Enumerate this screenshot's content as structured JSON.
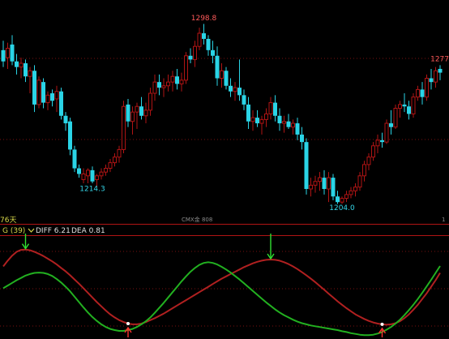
{
  "colors": {
    "background": "#000000",
    "bull": "#b01414",
    "bear": "#2ad4e6",
    "high_label": "#ff5a5a",
    "low_label": "#35d6e8",
    "grid": "#7a1010",
    "diff_line": "#b02020",
    "dea_line": "#22b020",
    "signal_up": "#ff3030",
    "signal_down": "#30e030"
  },
  "main_panel": {
    "left_label": "76天",
    "center_label": "CMX金 808",
    "right_label": "1"
  },
  "indicator_panel": {
    "name": "G (39)",
    "diff_label": "DIFF 6.21",
    "dea_label": "DEA 0.81"
  },
  "chart_data": [
    {
      "type": "candlestick",
      "ylim": [
        1195,
        1310
      ],
      "annotations": [
        {
          "text": "1298.8",
          "role": "high",
          "value": 1298.8,
          "index": 45
        },
        {
          "text": "1214.3",
          "role": "low",
          "value": 1214.3,
          "index": 20
        },
        {
          "text": "1204.0",
          "role": "low",
          "value": 1204.0,
          "index": 76
        },
        {
          "text": "1277",
          "role": "high",
          "value": 1277,
          "index": 98
        }
      ],
      "candles": [
        {
          "o": 1285,
          "h": 1290,
          "l": 1276,
          "c": 1279,
          "bull": false
        },
        {
          "o": 1281,
          "h": 1289,
          "l": 1275,
          "c": 1286,
          "bull": true
        },
        {
          "o": 1288,
          "h": 1293,
          "l": 1277,
          "c": 1279,
          "bull": false
        },
        {
          "o": 1279,
          "h": 1283,
          "l": 1272,
          "c": 1276,
          "bull": false
        },
        {
          "o": 1276,
          "h": 1281,
          "l": 1270,
          "c": 1278,
          "bull": true
        },
        {
          "o": 1278,
          "h": 1280,
          "l": 1268,
          "c": 1271,
          "bull": false
        },
        {
          "o": 1271,
          "h": 1276,
          "l": 1262,
          "c": 1274,
          "bull": true
        },
        {
          "o": 1274,
          "h": 1277,
          "l": 1252,
          "c": 1256,
          "bull": false
        },
        {
          "o": 1256,
          "h": 1271,
          "l": 1254,
          "c": 1269,
          "bull": true
        },
        {
          "o": 1268,
          "h": 1270,
          "l": 1254,
          "c": 1257,
          "bull": false
        },
        {
          "o": 1257,
          "h": 1263,
          "l": 1253,
          "c": 1261,
          "bull": true
        },
        {
          "o": 1262,
          "h": 1264,
          "l": 1255,
          "c": 1258,
          "bull": false
        },
        {
          "o": 1259,
          "h": 1266,
          "l": 1252,
          "c": 1263,
          "bull": true
        },
        {
          "o": 1263,
          "h": 1265,
          "l": 1248,
          "c": 1250,
          "bull": false
        },
        {
          "o": 1250,
          "h": 1252,
          "l": 1242,
          "c": 1246,
          "bull": false
        },
        {
          "o": 1247,
          "h": 1249,
          "l": 1229,
          "c": 1232,
          "bull": false
        },
        {
          "o": 1232,
          "h": 1234,
          "l": 1220,
          "c": 1222,
          "bull": false
        },
        {
          "o": 1222,
          "h": 1224,
          "l": 1217,
          "c": 1219,
          "bull": false
        },
        {
          "o": 1219,
          "h": 1222,
          "l": 1214,
          "c": 1216,
          "bull": true
        },
        {
          "o": 1218,
          "h": 1222,
          "l": 1214,
          "c": 1221,
          "bull": true
        },
        {
          "o": 1221,
          "h": 1223,
          "l": 1214,
          "c": 1215,
          "bull": false
        },
        {
          "o": 1216,
          "h": 1219,
          "l": 1212,
          "c": 1218,
          "bull": true
        },
        {
          "o": 1218,
          "h": 1222,
          "l": 1216,
          "c": 1220,
          "bull": true
        },
        {
          "o": 1220,
          "h": 1224,
          "l": 1218,
          "c": 1222,
          "bull": true
        },
        {
          "o": 1222,
          "h": 1227,
          "l": 1220,
          "c": 1225,
          "bull": true
        },
        {
          "o": 1225,
          "h": 1230,
          "l": 1223,
          "c": 1228,
          "bull": true
        },
        {
          "o": 1228,
          "h": 1234,
          "l": 1225,
          "c": 1232,
          "bull": true
        },
        {
          "o": 1232,
          "h": 1258,
          "l": 1230,
          "c": 1255,
          "bull": true
        },
        {
          "o": 1256,
          "h": 1259,
          "l": 1244,
          "c": 1247,
          "bull": false
        },
        {
          "o": 1247,
          "h": 1255,
          "l": 1240,
          "c": 1252,
          "bull": true
        },
        {
          "o": 1252,
          "h": 1257,
          "l": 1243,
          "c": 1255,
          "bull": true
        },
        {
          "o": 1255,
          "h": 1260,
          "l": 1248,
          "c": 1250,
          "bull": false
        },
        {
          "o": 1250,
          "h": 1257,
          "l": 1246,
          "c": 1253,
          "bull": true
        },
        {
          "o": 1253,
          "h": 1265,
          "l": 1250,
          "c": 1262,
          "bull": true
        },
        {
          "o": 1262,
          "h": 1272,
          "l": 1258,
          "c": 1268,
          "bull": true
        },
        {
          "o": 1268,
          "h": 1272,
          "l": 1261,
          "c": 1265,
          "bull": false
        },
        {
          "o": 1265,
          "h": 1270,
          "l": 1260,
          "c": 1266,
          "bull": true
        },
        {
          "o": 1266,
          "h": 1272,
          "l": 1263,
          "c": 1268,
          "bull": true
        },
        {
          "o": 1268,
          "h": 1274,
          "l": 1263,
          "c": 1271,
          "bull": true
        },
        {
          "o": 1271,
          "h": 1275,
          "l": 1264,
          "c": 1267,
          "bull": false
        },
        {
          "o": 1267,
          "h": 1273,
          "l": 1263,
          "c": 1269,
          "bull": true
        },
        {
          "o": 1269,
          "h": 1284,
          "l": 1267,
          "c": 1282,
          "bull": true
        },
        {
          "o": 1282,
          "h": 1286,
          "l": 1278,
          "c": 1280,
          "bull": false
        },
        {
          "o": 1280,
          "h": 1290,
          "l": 1276,
          "c": 1287,
          "bull": true
        },
        {
          "o": 1287,
          "h": 1297,
          "l": 1285,
          "c": 1294,
          "bull": true
        },
        {
          "o": 1294,
          "h": 1299,
          "l": 1288,
          "c": 1291,
          "bull": false
        },
        {
          "o": 1291,
          "h": 1293,
          "l": 1282,
          "c": 1285,
          "bull": false
        },
        {
          "o": 1285,
          "h": 1290,
          "l": 1278,
          "c": 1282,
          "bull": false
        },
        {
          "o": 1282,
          "h": 1287,
          "l": 1266,
          "c": 1270,
          "bull": false
        },
        {
          "o": 1270,
          "h": 1278,
          "l": 1265,
          "c": 1274,
          "bull": true
        },
        {
          "o": 1274,
          "h": 1276,
          "l": 1264,
          "c": 1266,
          "bull": false
        },
        {
          "o": 1266,
          "h": 1270,
          "l": 1260,
          "c": 1263,
          "bull": false
        },
        {
          "o": 1263,
          "h": 1268,
          "l": 1258,
          "c": 1265,
          "bull": true
        },
        {
          "o": 1265,
          "h": 1280,
          "l": 1258,
          "c": 1261,
          "bull": false
        },
        {
          "o": 1261,
          "h": 1264,
          "l": 1253,
          "c": 1256,
          "bull": false
        },
        {
          "o": 1256,
          "h": 1260,
          "l": 1243,
          "c": 1247,
          "bull": false
        },
        {
          "o": 1247,
          "h": 1253,
          "l": 1242,
          "c": 1249,
          "bull": true
        },
        {
          "o": 1249,
          "h": 1253,
          "l": 1244,
          "c": 1246,
          "bull": false
        },
        {
          "o": 1246,
          "h": 1250,
          "l": 1240,
          "c": 1248,
          "bull": true
        },
        {
          "o": 1248,
          "h": 1254,
          "l": 1244,
          "c": 1251,
          "bull": true
        },
        {
          "o": 1251,
          "h": 1260,
          "l": 1248,
          "c": 1257,
          "bull": true
        },
        {
          "o": 1257,
          "h": 1261,
          "l": 1247,
          "c": 1250,
          "bull": false
        },
        {
          "o": 1250,
          "h": 1254,
          "l": 1242,
          "c": 1246,
          "bull": false
        },
        {
          "o": 1246,
          "h": 1250,
          "l": 1241,
          "c": 1247,
          "bull": true
        },
        {
          "o": 1247,
          "h": 1251,
          "l": 1243,
          "c": 1244,
          "bull": false
        },
        {
          "o": 1244,
          "h": 1248,
          "l": 1240,
          "c": 1246,
          "bull": true
        },
        {
          "o": 1246,
          "h": 1249,
          "l": 1237,
          "c": 1240,
          "bull": false
        },
        {
          "o": 1240,
          "h": 1244,
          "l": 1232,
          "c": 1236,
          "bull": false
        },
        {
          "o": 1236,
          "h": 1238,
          "l": 1208,
          "c": 1211,
          "bull": false
        },
        {
          "o": 1211,
          "h": 1217,
          "l": 1207,
          "c": 1213,
          "bull": true
        },
        {
          "o": 1213,
          "h": 1218,
          "l": 1209,
          "c": 1215,
          "bull": true
        },
        {
          "o": 1215,
          "h": 1220,
          "l": 1210,
          "c": 1217,
          "bull": true
        },
        {
          "o": 1217,
          "h": 1221,
          "l": 1208,
          "c": 1211,
          "bull": false
        },
        {
          "o": 1211,
          "h": 1220,
          "l": 1204,
          "c": 1217,
          "bull": true
        },
        {
          "o": 1217,
          "h": 1219,
          "l": 1205,
          "c": 1207,
          "bull": false
        },
        {
          "o": 1207,
          "h": 1210,
          "l": 1203,
          "c": 1204,
          "bull": false
        },
        {
          "o": 1204,
          "h": 1207,
          "l": 1203,
          "c": 1206,
          "bull": true
        },
        {
          "o": 1206,
          "h": 1210,
          "l": 1204,
          "c": 1208,
          "bull": true
        },
        {
          "o": 1208,
          "h": 1212,
          "l": 1206,
          "c": 1210,
          "bull": true
        },
        {
          "o": 1210,
          "h": 1214,
          "l": 1207,
          "c": 1212,
          "bull": true
        },
        {
          "o": 1212,
          "h": 1220,
          "l": 1210,
          "c": 1218,
          "bull": true
        },
        {
          "o": 1218,
          "h": 1226,
          "l": 1215,
          "c": 1224,
          "bull": true
        },
        {
          "o": 1224,
          "h": 1230,
          "l": 1221,
          "c": 1228,
          "bull": true
        },
        {
          "o": 1228,
          "h": 1236,
          "l": 1226,
          "c": 1234,
          "bull": true
        },
        {
          "o": 1234,
          "h": 1240,
          "l": 1230,
          "c": 1237,
          "bull": true
        },
        {
          "o": 1237,
          "h": 1241,
          "l": 1233,
          "c": 1236,
          "bull": false
        },
        {
          "o": 1236,
          "h": 1248,
          "l": 1235,
          "c": 1246,
          "bull": true
        },
        {
          "o": 1246,
          "h": 1253,
          "l": 1240,
          "c": 1244,
          "bull": false
        },
        {
          "o": 1244,
          "h": 1256,
          "l": 1243,
          "c": 1254,
          "bull": true
        },
        {
          "o": 1254,
          "h": 1258,
          "l": 1249,
          "c": 1256,
          "bull": true
        },
        {
          "o": 1256,
          "h": 1262,
          "l": 1252,
          "c": 1255,
          "bull": false
        },
        {
          "o": 1255,
          "h": 1258,
          "l": 1248,
          "c": 1251,
          "bull": false
        },
        {
          "o": 1251,
          "h": 1262,
          "l": 1249,
          "c": 1260,
          "bull": true
        },
        {
          "o": 1260,
          "h": 1266,
          "l": 1258,
          "c": 1264,
          "bull": true
        },
        {
          "o": 1264,
          "h": 1268,
          "l": 1256,
          "c": 1260,
          "bull": false
        },
        {
          "o": 1260,
          "h": 1272,
          "l": 1258,
          "c": 1270,
          "bull": true
        },
        {
          "o": 1270,
          "h": 1275,
          "l": 1264,
          "c": 1268,
          "bull": false
        },
        {
          "o": 1268,
          "h": 1276,
          "l": 1265,
          "c": 1274,
          "bull": true
        },
        {
          "o": 1273,
          "h": 1277,
          "l": 1269,
          "c": 1275,
          "bull": false
        }
      ]
    },
    {
      "type": "line",
      "ylim": [
        -12,
        14
      ],
      "x_count": 99,
      "series": [
        {
          "name": "DIFF",
          "values": [
            6.5,
            8,
            9.3,
            10.3,
            10.8,
            10.9,
            10.7,
            10.3,
            9.8,
            9.2,
            8.5,
            7.8,
            7,
            6.1,
            5.2,
            4.2,
            3.1,
            2,
            0.8,
            -0.4,
            -1.6,
            -2.8,
            -3.9,
            -5,
            -6,
            -6.8,
            -7.5,
            -8,
            -8.4,
            -8.6,
            -8.6,
            -8.4,
            -8,
            -7.5,
            -7,
            -6.4,
            -5.8,
            -5.1,
            -4.4,
            -3.7,
            -3,
            -2.3,
            -1.6,
            -0.9,
            -0.2,
            0.5,
            1.2,
            1.9,
            2.6,
            3.3,
            3.9,
            4.5,
            5.1,
            5.7,
            6.3,
            6.8,
            7.3,
            7.7,
            8,
            8.2,
            8.3,
            8.2,
            8,
            7.6,
            7.1,
            6.5,
            5.8,
            5,
            4.2,
            3.3,
            2.4,
            1.4,
            0.4,
            -0.6,
            -1.6,
            -2.6,
            -3.5,
            -4.4,
            -5.2,
            -6,
            -6.6,
            -7.2,
            -7.7,
            -8.1,
            -8.4,
            -8.6,
            -8.7,
            -8.6,
            -8.3,
            -7.8,
            -7,
            -6,
            -4.8,
            -3.5,
            -2,
            -0.5,
            1.2,
            2.9,
            4.8
          ]
        },
        {
          "name": "DEA",
          "values": [
            0.8,
            1.5,
            2.2,
            2.9,
            3.5,
            4.1,
            4.5,
            4.8,
            4.9,
            4.8,
            4.5,
            4,
            3.2,
            2.3,
            1.2,
            0,
            -1.4,
            -2.8,
            -4.2,
            -5.5,
            -6.7,
            -7.7,
            -8.6,
            -9.3,
            -9.8,
            -10.1,
            -10.3,
            -10.3,
            -10.1,
            -9.8,
            -9.3,
            -8.6,
            -7.8,
            -6.8,
            -5.6,
            -4.3,
            -3,
            -1.6,
            -0.2,
            1.2,
            2.6,
            3.9,
            5.1,
            6.1,
            6.9,
            7.4,
            7.6,
            7.4,
            7,
            6.4,
            5.7,
            4.9,
            4,
            3.1,
            2.1,
            1.1,
            0.1,
            -0.9,
            -1.9,
            -2.9,
            -3.8,
            -4.7,
            -5.5,
            -6.2,
            -6.8,
            -7.4,
            -7.9,
            -8.3,
            -8.6,
            -8.9,
            -9.1,
            -9.3,
            -9.5,
            -9.7,
            -9.9,
            -10.1,
            -10.4,
            -10.6,
            -10.9,
            -11.1,
            -11.3,
            -11.4,
            -11.4,
            -11.3,
            -11,
            -10.6,
            -10,
            -9.3,
            -8.4,
            -7.4,
            -6.2,
            -4.9,
            -3.5,
            -2,
            -0.4,
            1.3,
            3,
            4.8,
            6.6
          ]
        }
      ],
      "signals": [
        {
          "type": "sell",
          "index": 5,
          "level": 10.9
        },
        {
          "type": "buy",
          "index": 28,
          "level": -8.4
        },
        {
          "type": "sell",
          "index": 60,
          "level": 8.3
        },
        {
          "type": "buy",
          "index": 85,
          "level": -8.6
        }
      ]
    }
  ]
}
